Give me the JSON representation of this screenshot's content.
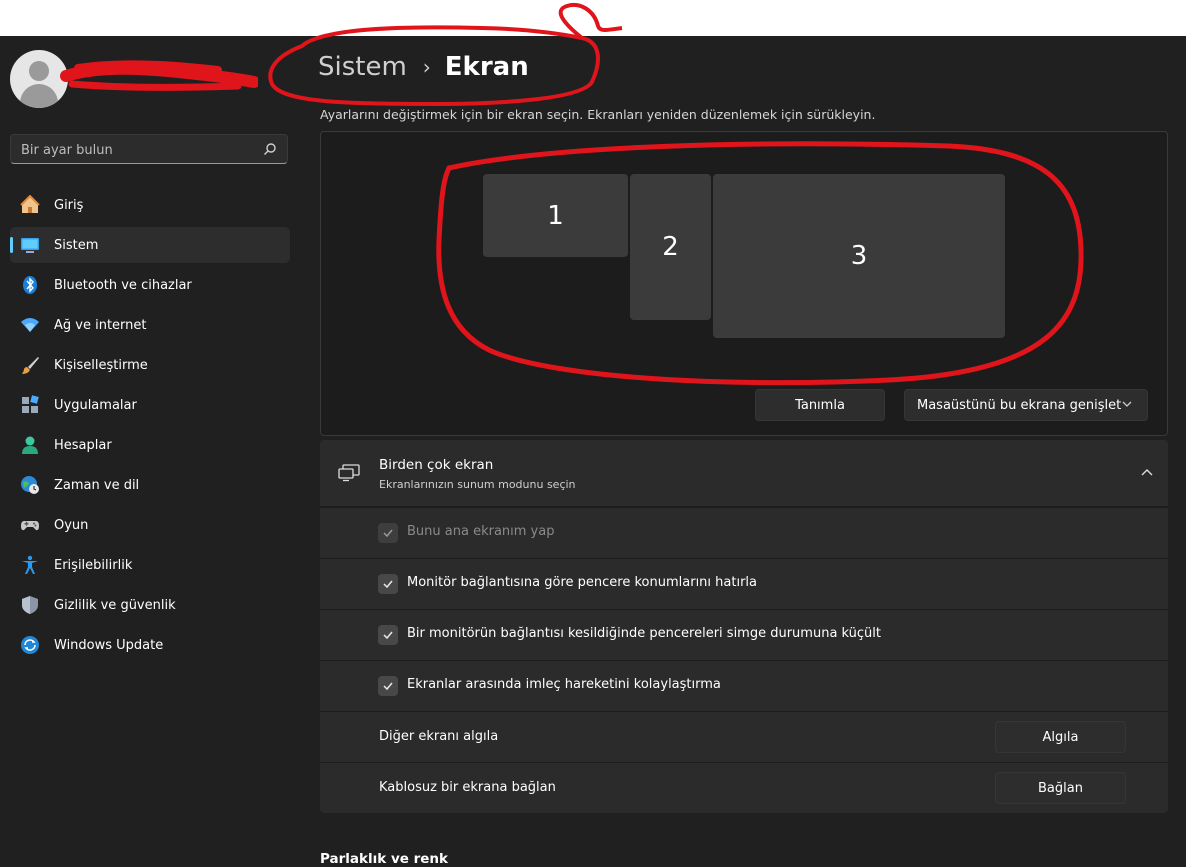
{
  "sidebar": {
    "search_placeholder": "Bir ayar bulun",
    "items": [
      {
        "label": "Giriş",
        "icon": "home-icon",
        "active": false
      },
      {
        "label": "Sistem",
        "icon": "system-monitor-icon",
        "active": true
      },
      {
        "label": "Bluetooth ve cihazlar",
        "icon": "bluetooth-icon",
        "active": false
      },
      {
        "label": "Ağ ve internet",
        "icon": "wifi-icon",
        "active": false
      },
      {
        "label": "Kişiselleştirme",
        "icon": "paintbrush-icon",
        "active": false
      },
      {
        "label": "Uygulamalar",
        "icon": "apps-icon",
        "active": false
      },
      {
        "label": "Hesaplar",
        "icon": "account-icon",
        "active": false
      },
      {
        "label": "Zaman ve dil",
        "icon": "globe-clock-icon",
        "active": false
      },
      {
        "label": "Oyun",
        "icon": "gamepad-icon",
        "active": false
      },
      {
        "label": "Erişilebilirlik",
        "icon": "accessibility-icon",
        "active": false
      },
      {
        "label": "Gizlilik ve güvenlik",
        "icon": "shield-icon",
        "active": false
      },
      {
        "label": "Windows Update",
        "icon": "update-icon",
        "active": false
      }
    ]
  },
  "header": {
    "breadcrumb_parent": "Sistem",
    "breadcrumb_current": "Ekran"
  },
  "arrange": {
    "instruction": "Ayarlarını değiştirmek için bir ekran seçin. Ekranları yeniden düzenlemek için sürükleyin.",
    "monitors": [
      "1",
      "2",
      "3"
    ],
    "identify_button": "Tanımla",
    "extend_select": "Masaüstünü bu ekrana genişlet"
  },
  "multi": {
    "title": "Birden çok ekran",
    "subtitle": "Ekranlarınızın sunum modunu seçin",
    "options": [
      {
        "label": "Bunu ana ekranım yap",
        "checked": true,
        "disabled": true
      },
      {
        "label": "Monitör bağlantısına göre pencere konumlarını hatırla",
        "checked": true,
        "disabled": false
      },
      {
        "label": "Bir monitörün bağlantısı kesildiğinde pencereleri simge durumuna küçült",
        "checked": true,
        "disabled": false
      },
      {
        "label": "Ekranlar arasında imleç hareketini kolaylaştırma",
        "checked": true,
        "disabled": false
      }
    ],
    "detect_label": "Diğer ekranı algıla",
    "detect_button": "Algıla",
    "wireless_label": "Kablosuz bir ekrana bağlan",
    "wireless_button": "Bağlan"
  },
  "next_section": "Parlaklık ve renk",
  "colors": {
    "accent": "#60cdff",
    "annotation": "#e0141b",
    "background": "#202020"
  }
}
